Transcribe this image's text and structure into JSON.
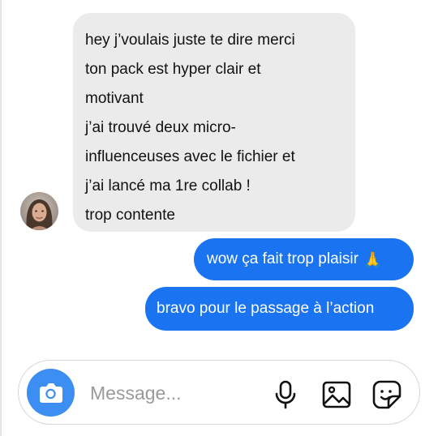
{
  "conversation": {
    "incoming": {
      "lines": [
        "hey j’voulais juste te dire merci",
        "ton pack est hyper clair et",
        "motivant",
        "j’ai trouvé deux micro-",
        "influenceuses avec le fichier et",
        "j’ai lancé ma 1re collab !",
        "trop contente"
      ]
    },
    "outgoing": [
      {
        "text": "wow ça fait trop plaisir",
        "emoji": "🙏"
      },
      {
        "text": "bravo pour le passage à l’action"
      }
    ]
  },
  "composer": {
    "placeholder": "Message...",
    "icons": [
      "camera-icon",
      "microphone-icon",
      "image-gallery-icon",
      "sticker-icon"
    ]
  },
  "colors": {
    "incoming_bubble": "#ebebeb",
    "outgoing_bubble": "#1a73f0",
    "camera_button": "#3d8ef3"
  }
}
